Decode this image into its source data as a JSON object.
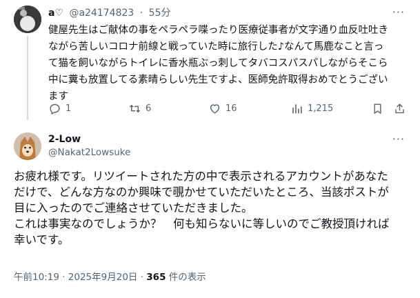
{
  "reply": {
    "display_name": "a♡",
    "handle": "@a24174823",
    "separator": "·",
    "time": "55分",
    "more_label": "···",
    "lines": [
      "健屋先生はご献体の事をペラペラ喋ったり医療従事者が文字通り血反吐吐き",
      "ながら苦しいコロナ前線と戦っていた時に旅行した♪なんて馬鹿なこと言っ",
      "て猫を飼いながらトイレに香水瓶ぶっ刺してタバコスパスパしながらそこら",
      "中に糞も放置してる素晴らしい先生ですよ、医師免許取得おめでとうござい",
      "ます"
    ],
    "counts": {
      "replies": "1",
      "reposts": "6",
      "likes": "16",
      "views": "1,215"
    }
  },
  "main_post": {
    "display_name": "2-Low",
    "handle": "@Nakat2Lowsuke",
    "more_label": "···",
    "lines": [
      "お疲れ様です。リツイートされた方の中で表示されるアカウントがあなた",
      "だけで、どんな方なのか興味で覗かせていただいたところ、当該ポストが",
      "目に入ったのでご連絡させていただきました。",
      "これは事実なのでしょうか？　何も知らないに等しいのでご教授頂ければ",
      "幸いです。"
    ],
    "timestamp": "午前10:19 · 2025年9月20日 · ",
    "views_count": "365",
    "views_label": " 件の表示"
  }
}
